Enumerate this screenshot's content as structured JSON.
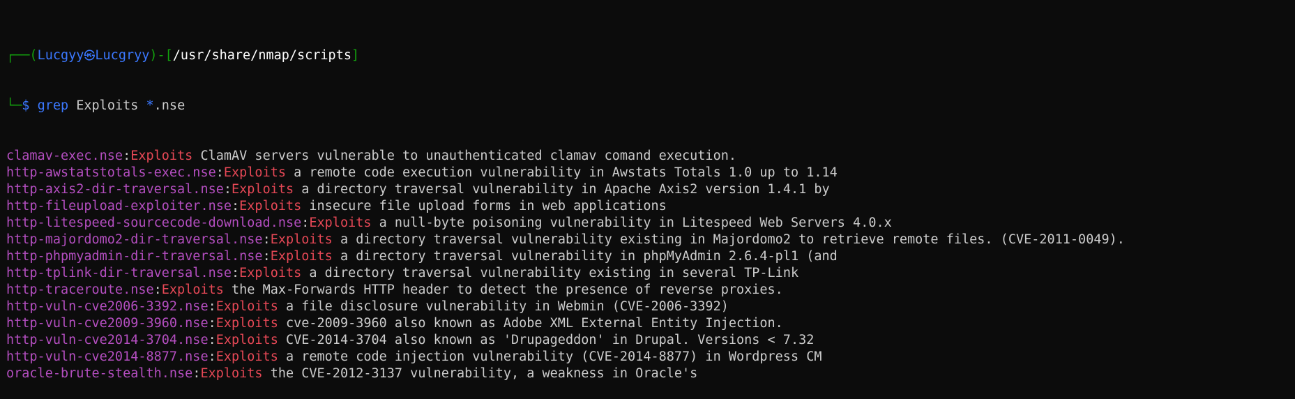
{
  "prompt": {
    "corner_top": "┌──(",
    "user": "Lucgyy",
    "at_symbol": "㉿",
    "host": "Lucgryy",
    "mid": ")-[",
    "cwd": "/usr/share/nmap/scripts",
    "end": "]",
    "corner_bottom": "└─",
    "dollar": "$ "
  },
  "command": {
    "name": "grep",
    "args": " Exploits ",
    "glob_star": "*",
    "glob_ext": ".nse"
  },
  "results": [
    {
      "file": "clamav-exec.nse",
      "match": "Exploits",
      "text": " ClamAV servers vulnerable to unauthenticated clamav comand execution."
    },
    {
      "file": "http-awstatstotals-exec.nse",
      "match": "Exploits",
      "text": " a remote code execution vulnerability in Awstats Totals 1.0 up to 1.14"
    },
    {
      "file": "http-axis2-dir-traversal.nse",
      "match": "Exploits",
      "text": " a directory traversal vulnerability in Apache Axis2 version 1.4.1 by"
    },
    {
      "file": "http-fileupload-exploiter.nse",
      "match": "Exploits",
      "text": " insecure file upload forms in web applications"
    },
    {
      "file": "http-litespeed-sourcecode-download.nse",
      "match": "Exploits",
      "text": " a null-byte poisoning vulnerability in Litespeed Web Servers 4.0.x"
    },
    {
      "file": "http-majordomo2-dir-traversal.nse",
      "match": "Exploits",
      "text": " a directory traversal vulnerability existing in Majordomo2 to retrieve remote files. (CVE-2011-0049)."
    },
    {
      "file": "http-phpmyadmin-dir-traversal.nse",
      "match": "Exploits",
      "text": " a directory traversal vulnerability in phpMyAdmin 2.6.4-pl1 (and"
    },
    {
      "file": "http-tplink-dir-traversal.nse",
      "match": "Exploits",
      "text": " a directory traversal vulnerability existing in several TP-Link"
    },
    {
      "file": "http-traceroute.nse",
      "match": "Exploits",
      "text": " the Max-Forwards HTTP header to detect the presence of reverse proxies."
    },
    {
      "file": "http-vuln-cve2006-3392.nse",
      "match": "Exploits",
      "text": " a file disclosure vulnerability in Webmin (CVE-2006-3392)"
    },
    {
      "file": "http-vuln-cve2009-3960.nse",
      "match": "Exploits",
      "text": " cve-2009-3960 also known as Adobe XML External Entity Injection."
    },
    {
      "file": "http-vuln-cve2014-3704.nse",
      "match": "Exploits",
      "text": " CVE-2014-3704 also known as 'Drupageddon' in Drupal. Versions < 7.32"
    },
    {
      "file": "http-vuln-cve2014-8877.nse",
      "match": "Exploits",
      "text": " a remote code injection vulnerability (CVE-2014-8877) in Wordpress CM"
    },
    {
      "file": "oracle-brute-stealth.nse",
      "match": "Exploits",
      "text": " the CVE-2012-3137 vulnerability, a weakness in Oracle's"
    }
  ],
  "colors": {
    "background": "#0c0c0c",
    "prompt_frame": "#13a10e",
    "user_host": "#3b78ff",
    "filename": "#b44ec0",
    "match": "#e74856",
    "text": "#cccccc"
  }
}
